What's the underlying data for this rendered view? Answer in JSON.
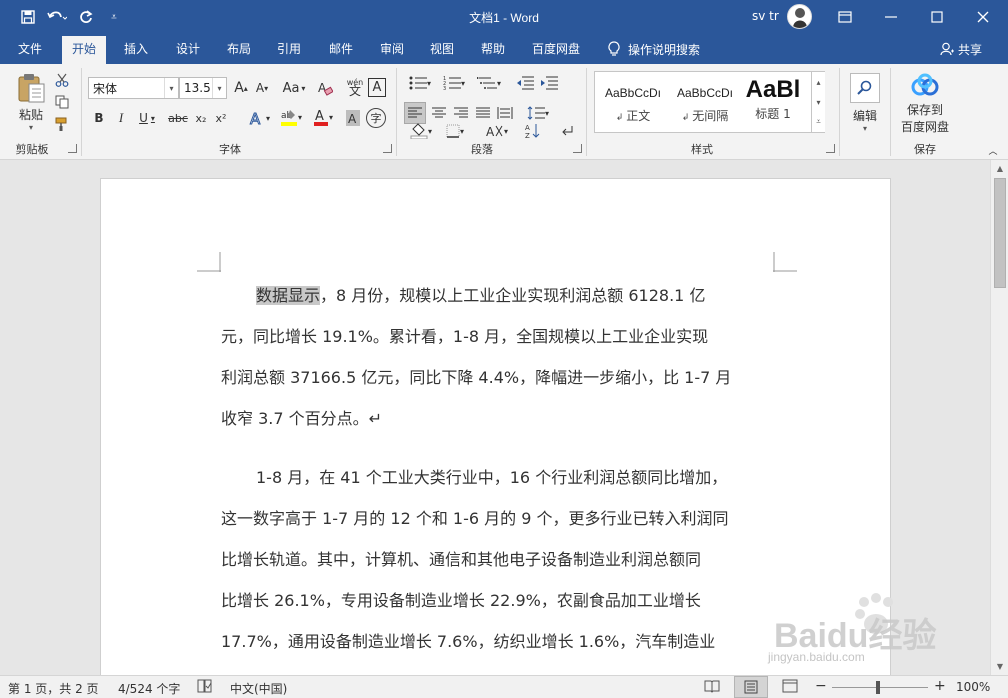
{
  "window": {
    "title": "文档1 - Word",
    "user": "sv tr"
  },
  "tabs": [
    "文件",
    "开始",
    "插入",
    "设计",
    "布局",
    "引用",
    "邮件",
    "审阅",
    "视图",
    "帮助",
    "百度网盘"
  ],
  "active_tab": "开始",
  "tell_me": "操作说明搜索",
  "share_label": "共享",
  "ribbon": {
    "clipboard": {
      "paste_label": "粘贴",
      "group_label": "剪贴板"
    },
    "font": {
      "font_name": "宋体",
      "font_size": "13.5",
      "group_label": "字体",
      "bold": "B",
      "italic": "I",
      "underline": "U",
      "strike": "abc",
      "subscript": "x₂",
      "superscript": "x²",
      "grow": "A",
      "shrink": "A",
      "case": "Aa",
      "phonetic": "wén",
      "border_char": "A",
      "enclose": "字"
    },
    "paragraph": {
      "group_label": "段落"
    },
    "styles": {
      "group_label": "样式",
      "items": [
        {
          "sample": "AaBbCcDı",
          "name": "正文"
        },
        {
          "sample": "AaBbCcDı",
          "name": "无间隔"
        },
        {
          "sample": "AaBl",
          "name": "标题 1"
        }
      ]
    },
    "editing": {
      "label": "编辑"
    },
    "save": {
      "line1": "保存到",
      "line2": "百度网盘",
      "group_label": "保存"
    }
  },
  "document": {
    "paragraphs": [
      {
        "lines": [
          {
            "selected": "数据显示",
            "text": "，8 月份，规模以上工业企业实现利润总额 6128.1 亿"
          },
          {
            "text": "元，同比增长 19.1%。累计看，1-8 月，全国规模以上工业企业实现"
          },
          {
            "text": "利润总额 37166.5 亿元，同比下降 4.4%，降幅进一步缩小，比 1-7 月"
          },
          {
            "text": "收窄 3.7 个百分点。↵"
          }
        ]
      },
      {
        "lines": [
          {
            "text": "1-8 月，在 41 个工业大类行业中，16 个行业利润总额同比增加，"
          },
          {
            "text": "这一数字高于 1-7 月的 12 个和 1-6 月的 9 个，更多行业已转入利润同"
          },
          {
            "text": "比增长轨道。其中，计算机、通信和其他电子设备制造业利润总额同"
          },
          {
            "text": "比增长 26.1%，专用设备制造业增长 22.9%，农副食品加工业增长"
          },
          {
            "text": "17.7%，通用设备制造业增长 7.6%，纺织业增长 1.6%，汽车制造业"
          }
        ]
      }
    ]
  },
  "status": {
    "page": "第 1 页，共 2 页",
    "words": "4/524 个字",
    "language": "中文(中国)",
    "zoom": "100%",
    "zoom_level": 1.0
  },
  "watermark": {
    "brand": "Baidu经验",
    "url": "jingyan.baidu.com"
  },
  "colors": {
    "accent": "#2b579a",
    "ribbon_bg": "#f3f3f3",
    "selection": "#c8c8c8"
  }
}
